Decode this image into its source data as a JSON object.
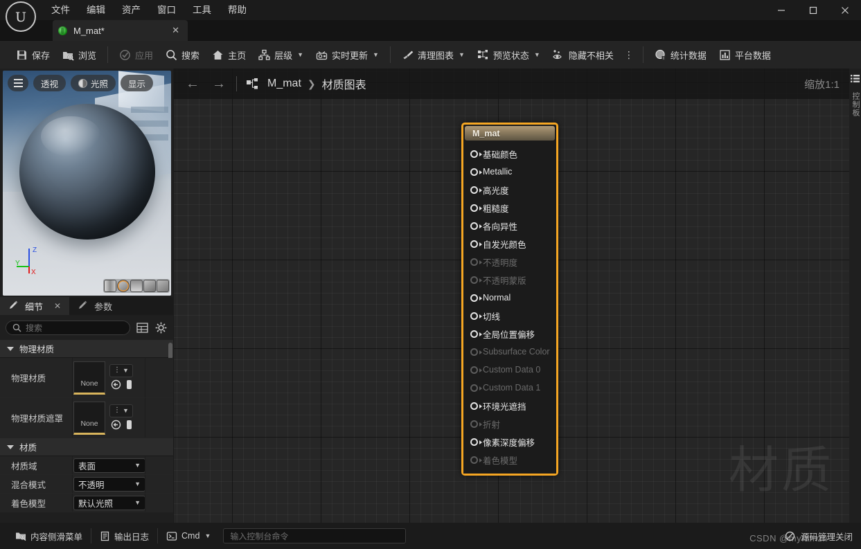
{
  "window": {
    "app_icon": "unreal-engine-logo",
    "minimize": "—",
    "maximize": "▢",
    "close": "✕"
  },
  "menubar": {
    "items": [
      {
        "label": "文件",
        "name": "menu-file"
      },
      {
        "label": "编辑",
        "name": "menu-edit"
      },
      {
        "label": "资产",
        "name": "menu-asset"
      },
      {
        "label": "窗口",
        "name": "menu-window"
      },
      {
        "label": "工具",
        "name": "menu-tools"
      },
      {
        "label": "帮助",
        "name": "menu-help"
      }
    ]
  },
  "tab": {
    "label": "M_mat*",
    "close": "✕",
    "icon": "material-asset-icon"
  },
  "toolbar": {
    "items": [
      {
        "label": "保存",
        "icon": "save-icon",
        "disabled": false,
        "caret": false
      },
      {
        "label": "浏览",
        "icon": "browse-icon",
        "disabled": false,
        "caret": false
      },
      {
        "label": "应用",
        "icon": "apply-icon",
        "disabled": true,
        "caret": false
      },
      {
        "label": "搜索",
        "icon": "search-icon",
        "disabled": false,
        "caret": false
      },
      {
        "label": "主页",
        "icon": "home-icon",
        "disabled": false,
        "caret": false
      },
      {
        "label": "层级",
        "icon": "hierarchy-icon",
        "disabled": false,
        "caret": true
      },
      {
        "label": "实时更新",
        "icon": "live-update-icon",
        "disabled": false,
        "caret": true
      },
      {
        "label": "清理图表",
        "icon": "clean-graph-icon",
        "disabled": false,
        "caret": true
      },
      {
        "label": "预览状态",
        "icon": "preview-state-icon",
        "disabled": false,
        "caret": true
      },
      {
        "label": "隐藏不相关",
        "icon": "hide-unrelated-icon",
        "disabled": false,
        "caret": false
      },
      {
        "label": "统计数据",
        "icon": "stats-icon",
        "disabled": false,
        "caret": false
      },
      {
        "label": "平台数据",
        "icon": "platform-stats-icon",
        "disabled": false,
        "caret": false
      }
    ],
    "overflow": "⋮"
  },
  "viewport": {
    "menu_icon": "hamburger-icon",
    "buttons": [
      {
        "label": "透视",
        "name": "viewport-perspective-button"
      },
      {
        "label": "光照",
        "name": "viewport-lighting-button",
        "icon": "lighting-icon"
      },
      {
        "label": "显示",
        "name": "viewport-show-button"
      }
    ],
    "gizmo": {
      "x": "X",
      "y": "Y",
      "z": "Z"
    },
    "preview_shapes": [
      "cylinder",
      "sphere",
      "plane",
      "cube",
      "custom-mesh"
    ],
    "selected_shape_index": 1
  },
  "details": {
    "tabs": [
      {
        "label": "细节",
        "active": true,
        "icon": "details-icon",
        "close": "✕"
      },
      {
        "label": "参数",
        "active": false,
        "icon": "params-icon"
      }
    ],
    "search_placeholder": "搜索",
    "search_value": "",
    "grid_icon": "grid-view-icon",
    "settings_icon": "gear-icon",
    "sections": [
      {
        "title": "物理材质",
        "rows": [
          {
            "label": "物理材质",
            "type": "asset",
            "value": "None"
          },
          {
            "label": "物理材质遮罩",
            "type": "asset",
            "value": "None"
          }
        ]
      },
      {
        "title": "材质",
        "rows": [
          {
            "label": "材质域",
            "type": "combo",
            "value": "表面"
          },
          {
            "label": "混合模式",
            "type": "combo",
            "value": "不透明"
          },
          {
            "label": "着色模型",
            "type": "combo",
            "value": "默认光照"
          }
        ]
      }
    ]
  },
  "graph": {
    "back_arrow": "←",
    "forward_arrow": "→",
    "graph_icon": "material-graph-icon",
    "breadcrumb": [
      "M_mat",
      "材质图表"
    ],
    "breadcrumb_sep": "❯",
    "zoom_label": "缩放1:1",
    "watermark": "材质"
  },
  "node": {
    "title": "M_mat",
    "pins": [
      {
        "label": "基础颜色",
        "enabled": true
      },
      {
        "label": "Metallic",
        "enabled": true
      },
      {
        "label": "高光度",
        "enabled": true
      },
      {
        "label": "粗糙度",
        "enabled": true
      },
      {
        "label": "各向异性",
        "enabled": true
      },
      {
        "label": "自发光颜色",
        "enabled": true
      },
      {
        "label": "不透明度",
        "enabled": false
      },
      {
        "label": "不透明蒙版",
        "enabled": false
      },
      {
        "label": "Normal",
        "enabled": true
      },
      {
        "label": "切线",
        "enabled": true
      },
      {
        "label": "全局位置偏移",
        "enabled": true
      },
      {
        "label": "Subsurface Color",
        "enabled": false
      },
      {
        "label": "Custom Data 0",
        "enabled": false
      },
      {
        "label": "Custom Data 1",
        "enabled": false
      },
      {
        "label": "环境光遮挡",
        "enabled": true
      },
      {
        "label": "折射",
        "enabled": false
      },
      {
        "label": "像素深度偏移",
        "enabled": true
      },
      {
        "label": "着色模型",
        "enabled": false
      }
    ]
  },
  "right_rail": {
    "icon": "panel-list-icon",
    "label": "控制板"
  },
  "statusbar": {
    "content_drawer": {
      "label": "内容侧滑菜单",
      "icon": "content-drawer-icon"
    },
    "output_log": {
      "label": "输出日志",
      "icon": "output-log-icon"
    },
    "cmd": {
      "label": "Cmd",
      "icon": "console-icon",
      "caret": "⌄"
    },
    "cmd_placeholder": "输入控制台命令",
    "source_control": {
      "label": "源码管理关闭",
      "icon": "source-control-off-icon"
    },
    "watermark": "CSDN @myfamzh"
  },
  "colors": {
    "accent_orange": "#f5a623",
    "node_header": "#8a7a5e",
    "panel_bg": "#242424",
    "window_bg": "#1b1b1b",
    "asset_underline": "#d8b45c"
  }
}
